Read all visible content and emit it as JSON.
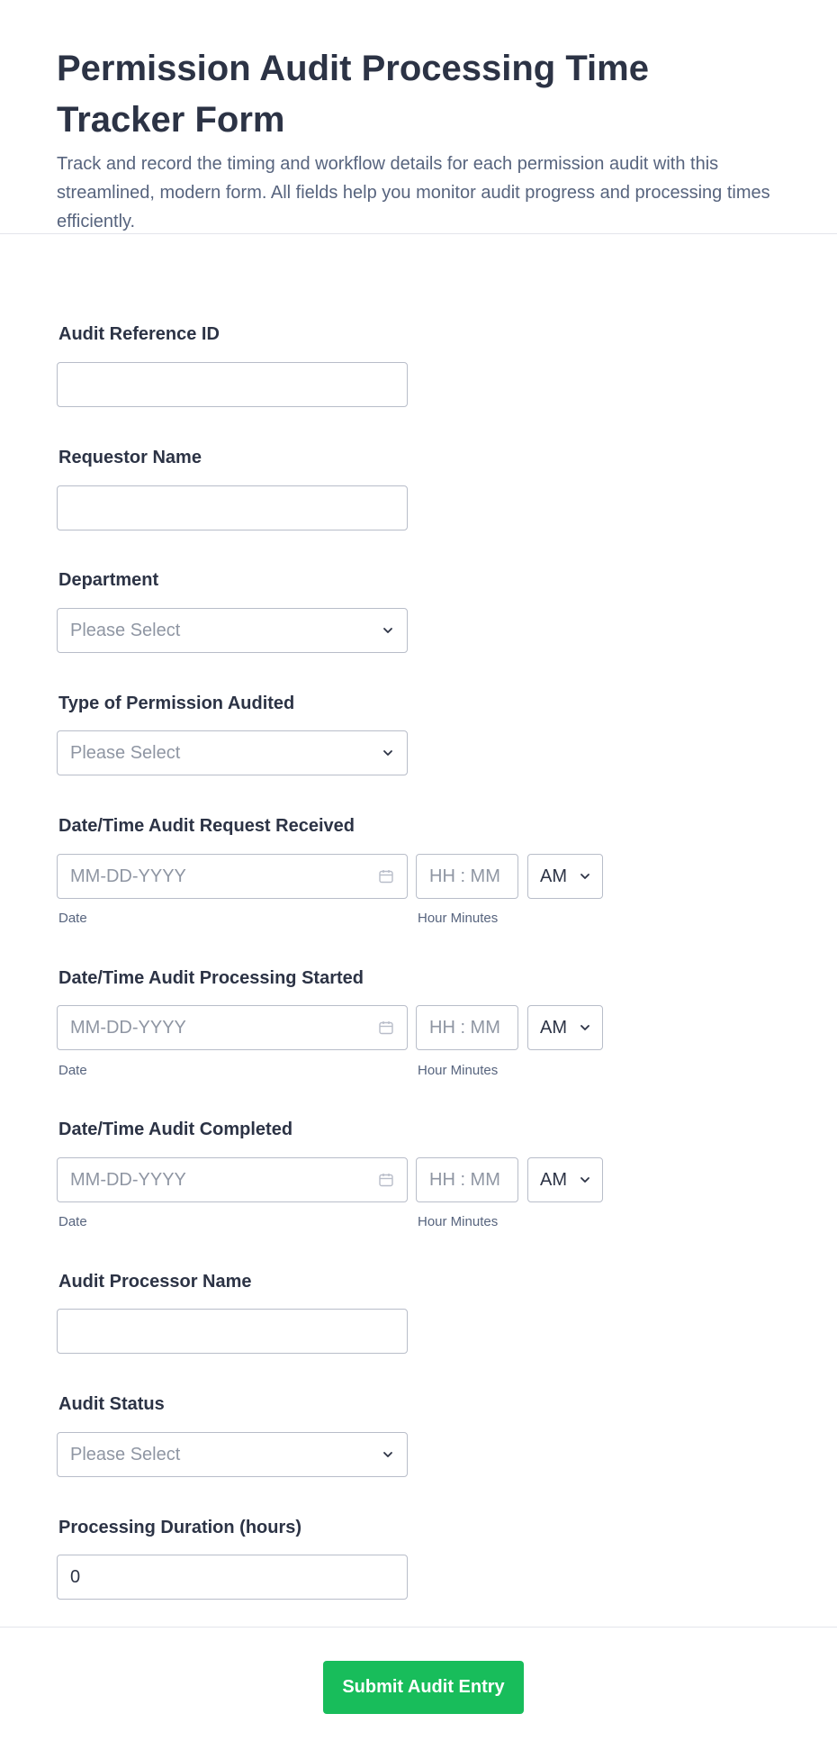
{
  "form": {
    "title": "Permission Audit Processing Time Tracker Form",
    "description": "Track and record the timing and workflow details for each permission audit with this streamlined, modern form. All fields help you monitor audit progress and processing times efficiently.",
    "fields": {
      "audit_reference_id": {
        "label": "Audit Reference ID",
        "value": ""
      },
      "requestor_name": {
        "label": "Requestor Name",
        "value": ""
      },
      "department": {
        "label": "Department",
        "placeholder": "Please Select"
      },
      "permission_type": {
        "label": "Type of Permission Audited",
        "placeholder": "Please Select"
      },
      "request_received": {
        "label": "Date/Time Audit Request Received",
        "date_placeholder": "MM-DD-YYYY",
        "time_placeholder": "HH : MM",
        "ampm": "AM",
        "date_sublabel": "Date",
        "time_sublabel": "Hour Minutes"
      },
      "processing_started": {
        "label": "Date/Time Audit Processing Started",
        "date_placeholder": "MM-DD-YYYY",
        "time_placeholder": "HH : MM",
        "ampm": "AM",
        "date_sublabel": "Date",
        "time_sublabel": "Hour Minutes"
      },
      "audit_completed": {
        "label": "Date/Time Audit Completed",
        "date_placeholder": "MM-DD-YYYY",
        "time_placeholder": "HH : MM",
        "ampm": "AM",
        "date_sublabel": "Date",
        "time_sublabel": "Hour Minutes"
      },
      "processor_name": {
        "label": "Audit Processor Name",
        "value": ""
      },
      "audit_status": {
        "label": "Audit Status",
        "placeholder": "Please Select"
      },
      "processing_duration": {
        "label": "Processing Duration (hours)",
        "value": "0"
      }
    },
    "submit_label": "Submit Audit Entry"
  },
  "colors": {
    "accent": "#18bd5b",
    "text": "#2c3345",
    "muted": "#57647e",
    "placeholder": "#8f96a3",
    "border": "#b8bdc9"
  },
  "icons": {
    "select": "chevron-down-icon",
    "date": "calendar-icon"
  }
}
